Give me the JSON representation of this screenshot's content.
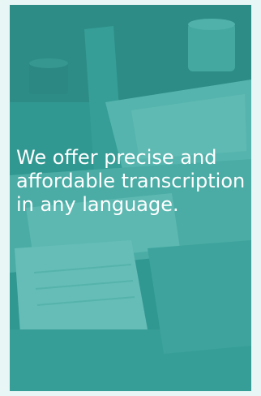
{
  "hero": {
    "headline": "We offer precise and affordable transcription in any language.",
    "overlay_color": "#34a8a0",
    "image_subject": "desk-with-laptop-and-papers"
  }
}
